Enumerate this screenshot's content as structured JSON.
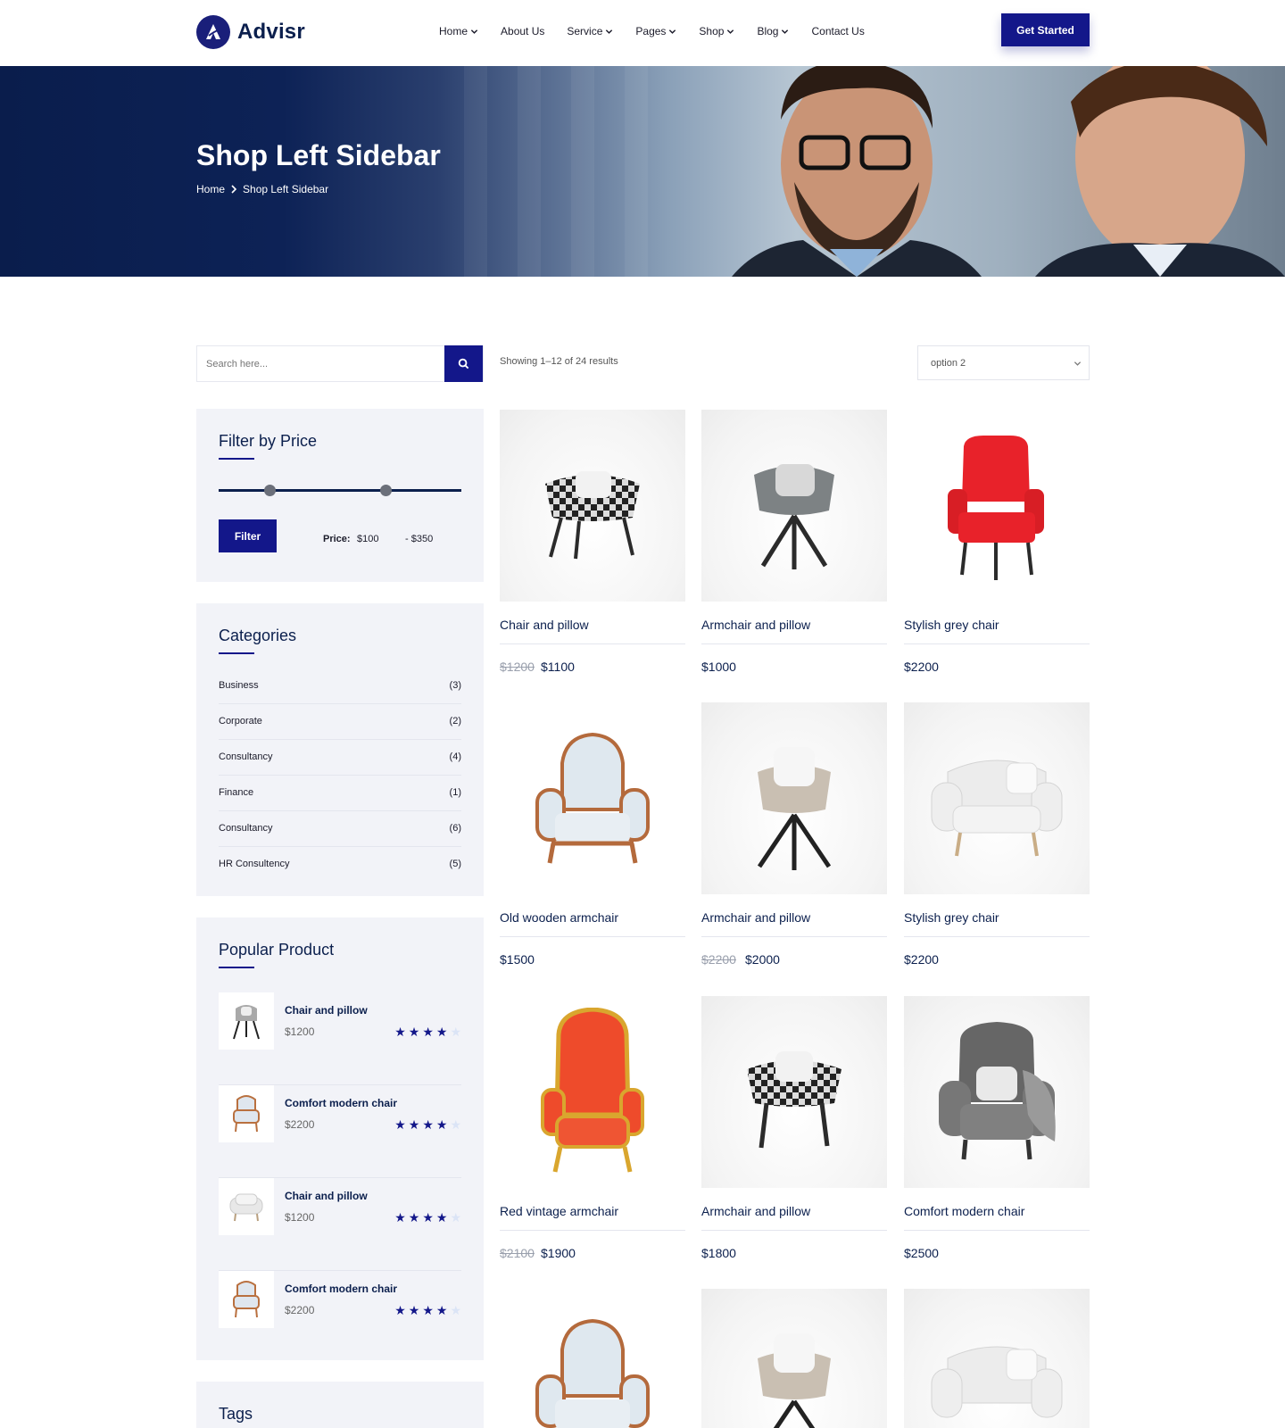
{
  "brand": {
    "name": "Advisr",
    "color": "#13178a"
  },
  "nav": {
    "items": [
      {
        "label": "Home",
        "dropdown": true
      },
      {
        "label": "About Us",
        "dropdown": false
      },
      {
        "label": "Service",
        "dropdown": true
      },
      {
        "label": "Pages",
        "dropdown": true
      },
      {
        "label": "Shop",
        "dropdown": true
      },
      {
        "label": "Blog",
        "dropdown": true
      },
      {
        "label": "Contact Us",
        "dropdown": false
      }
    ],
    "cta_label": "Get Started"
  },
  "hero": {
    "title": "Shop Left Sidebar",
    "breadcrumb": {
      "home": "Home",
      "current": "Shop Left Sidebar"
    }
  },
  "search": {
    "placeholder": "Search here...",
    "icon": "search-icon"
  },
  "results": {
    "text": "Showing 1–12 of 24 results"
  },
  "sort": {
    "selected": "option 2"
  },
  "filter_price": {
    "title": "Filter by Price",
    "button_label": "Filter",
    "price_label": "Price:",
    "min": "$100",
    "max": "- $350"
  },
  "categories": {
    "title": "Categories",
    "items": [
      {
        "name": "Business",
        "count": "(3)"
      },
      {
        "name": "Corporate",
        "count": "(2)"
      },
      {
        "name": "Consultancy",
        "count": "(4)"
      },
      {
        "name": "Finance",
        "count": "(1)"
      },
      {
        "name": "Consultancy",
        "count": "(6)"
      },
      {
        "name": "HR Consultency",
        "count": "(5)"
      }
    ]
  },
  "popular": {
    "title": "Popular Product",
    "items": [
      {
        "name": "Chair and pillow",
        "price": "$1200",
        "rating": 4,
        "max_rating": 5
      },
      {
        "name": "Comfort modern chair",
        "price": "$2200",
        "rating": 4,
        "max_rating": 5
      },
      {
        "name": "Chair and pillow",
        "price": "$1200",
        "rating": 4,
        "max_rating": 5
      },
      {
        "name": "Comfort modern chair",
        "price": "$2200",
        "rating": 4,
        "max_rating": 5
      }
    ]
  },
  "tags": {
    "title": "Tags"
  },
  "products": [
    {
      "name": "Chair and pillow",
      "old_price": "$1200",
      "price": "$1100"
    },
    {
      "name": "Armchair and pillow",
      "old_price": "",
      "price": "$1000"
    },
    {
      "name": "Stylish grey chair",
      "old_price": "",
      "price": "$2200"
    },
    {
      "name": "Old wooden armchair",
      "old_price": "",
      "price": "$1500"
    },
    {
      "name": "Armchair and pillow",
      "old_price": "$2200",
      "price": "$2000"
    },
    {
      "name": "Stylish grey chair",
      "old_price": "",
      "price": "$2200"
    },
    {
      "name": "Red vintage armchair",
      "old_price": "$2100",
      "price": "$1900"
    },
    {
      "name": "Armchair and pillow",
      "old_price": "",
      "price": "$1800"
    },
    {
      "name": "Comfort modern chair",
      "old_price": "",
      "price": "$2500"
    }
  ]
}
